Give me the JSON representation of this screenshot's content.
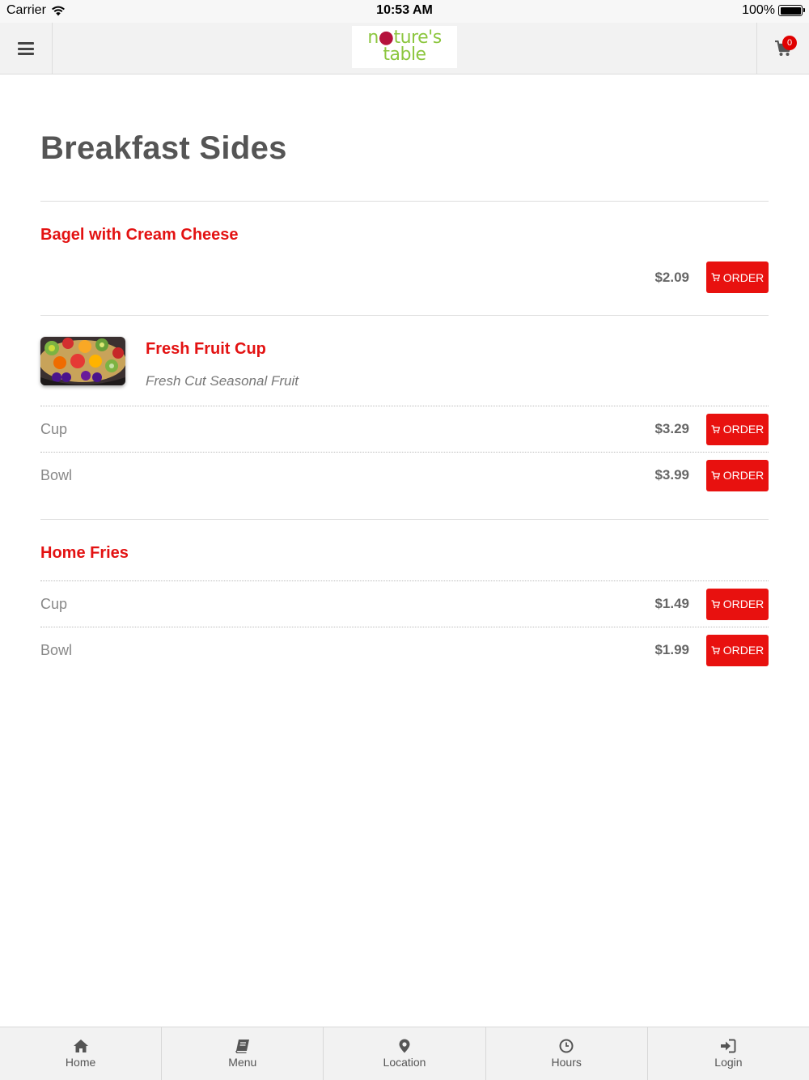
{
  "status_bar": {
    "carrier": "Carrier",
    "time": "10:53 AM",
    "battery": "100%"
  },
  "header": {
    "logo_line1_a": "n",
    "logo_line1_b": "ture's",
    "logo_line2": "table",
    "cart_count": "0"
  },
  "page": {
    "title": "Breakfast Sides"
  },
  "items": [
    {
      "name": "Bagel with Cream Cheese",
      "price": "$2.09",
      "order_label": "ORDER"
    },
    {
      "name": "Fresh Fruit Cup",
      "description": "Fresh Cut Seasonal Fruit",
      "options": [
        {
          "label": "Cup",
          "price": "$3.29",
          "order_label": "ORDER"
        },
        {
          "label": "Bowl",
          "price": "$3.99",
          "order_label": "ORDER"
        }
      ]
    },
    {
      "name": "Home Fries",
      "options": [
        {
          "label": "Cup",
          "price": "$1.49",
          "order_label": "ORDER"
        },
        {
          "label": "Bowl",
          "price": "$1.99",
          "order_label": "ORDER"
        }
      ]
    }
  ],
  "tabs": [
    {
      "label": "Home",
      "icon": "home-icon"
    },
    {
      "label": "Menu",
      "icon": "book-icon"
    },
    {
      "label": "Location",
      "icon": "map-pin-icon"
    },
    {
      "label": "Hours",
      "icon": "clock-icon"
    },
    {
      "label": "Login",
      "icon": "sign-in-icon"
    }
  ],
  "colors": {
    "accent": "#e8110f",
    "item_name": "#e31212",
    "logo_green": "#8cc63f",
    "logo_berry": "#b5123c"
  }
}
